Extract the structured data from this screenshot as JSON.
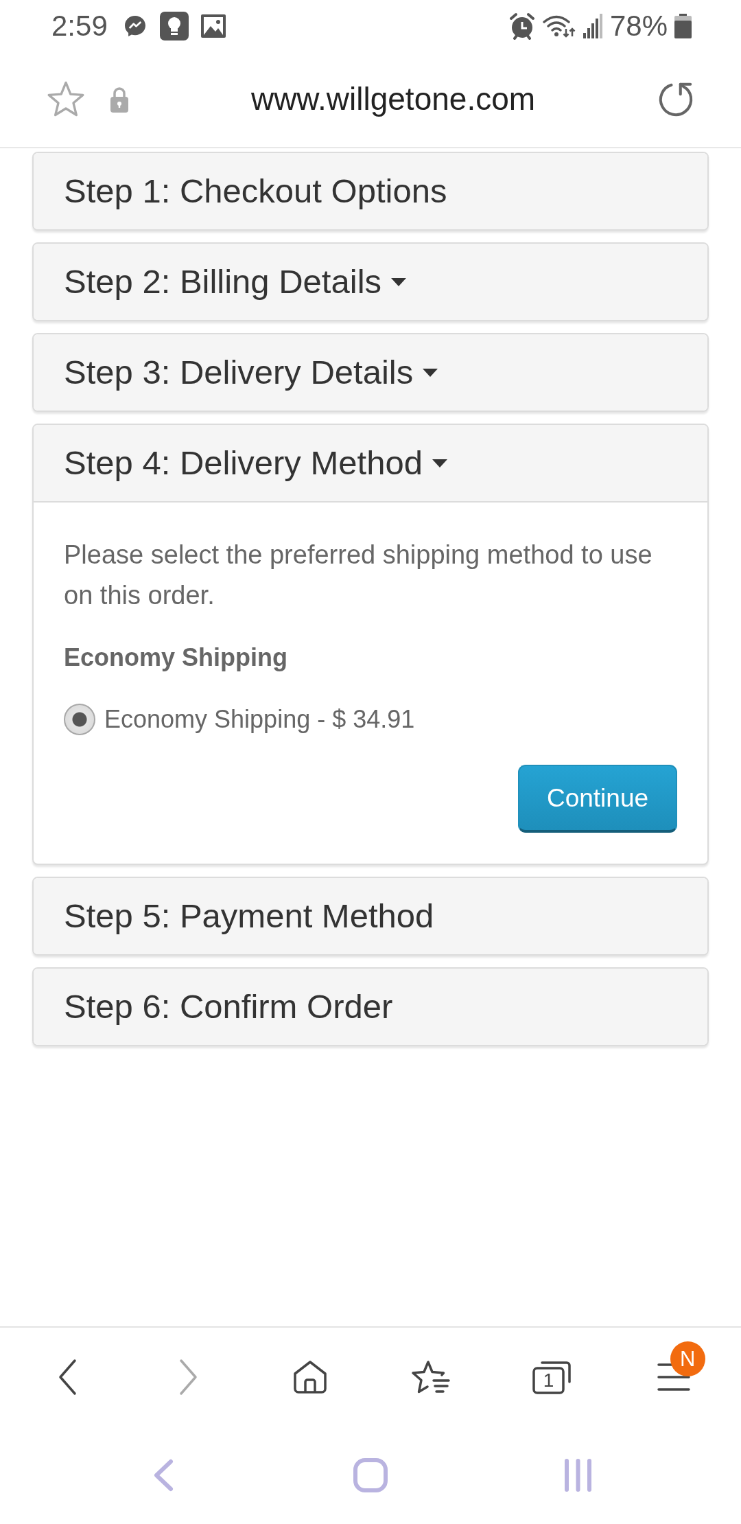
{
  "status_bar": {
    "time": "2:59",
    "battery": "78%"
  },
  "address_bar": {
    "url": "www.willgetone.com"
  },
  "checkout_steps": [
    {
      "title": "Step 1: Checkout Options",
      "collapsible": false,
      "expanded": false
    },
    {
      "title": "Step 2: Billing Details",
      "collapsible": true,
      "expanded": false
    },
    {
      "title": "Step 3: Delivery Details",
      "collapsible": true,
      "expanded": false
    },
    {
      "title": "Step 4: Delivery Method",
      "collapsible": true,
      "expanded": true,
      "body": {
        "instructions": "Please select the preferred shipping method to use on this order.",
        "method_title": "Economy Shipping",
        "options": [
          {
            "label": "Economy Shipping - $ 34.91",
            "selected": true
          }
        ],
        "button": "Continue"
      }
    },
    {
      "title": "Step 5: Payment Method",
      "collapsible": false,
      "expanded": false
    },
    {
      "title": "Step 6: Confirm Order",
      "collapsible": false,
      "expanded": false
    }
  ],
  "browser_toolbar": {
    "buttons": [
      {
        "kind": "back",
        "disabled": false
      },
      {
        "kind": "forward",
        "disabled": true
      },
      {
        "kind": "home",
        "disabled": false
      },
      {
        "kind": "bookmarks",
        "disabled": false
      },
      {
        "kind": "tabs",
        "disabled": false,
        "count": "1"
      },
      {
        "kind": "menu",
        "disabled": false,
        "badge": "N"
      }
    ]
  }
}
